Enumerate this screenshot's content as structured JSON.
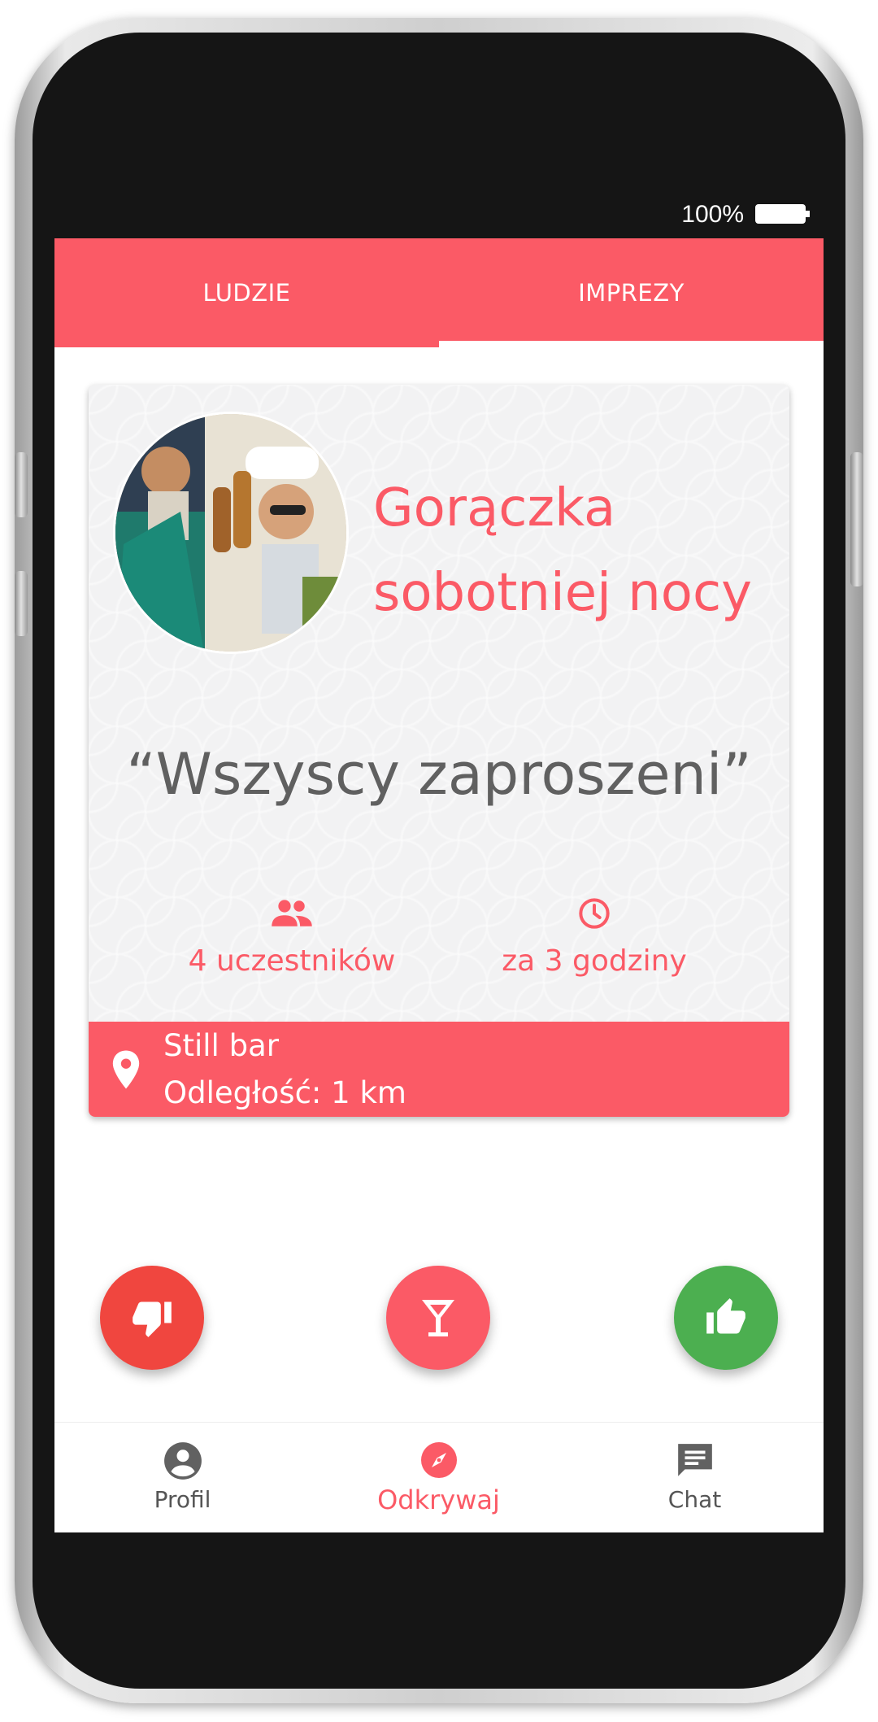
{
  "status_bar": {
    "battery_percent": "100%"
  },
  "tabs": [
    {
      "label": "LUDZIE",
      "active": false
    },
    {
      "label": "IMPREZY",
      "active": true
    }
  ],
  "event": {
    "title_line1": "Gorączka",
    "title_line2": "sobotniej nocy",
    "quote": "“Wszyscy zaproszeni”",
    "participants": "4 uczestników",
    "time_until": "za 3 godziny",
    "venue_name": "Still bar",
    "distance": "Odległość: 1 km"
  },
  "actions": {
    "dislike_icon": "thumb-down-icon",
    "drink_icon": "cocktail-glass-icon",
    "like_icon": "thumb-up-icon"
  },
  "bottom_nav": [
    {
      "label": "Profil",
      "icon": "account-circle-icon",
      "active": false
    },
    {
      "label": "Odkrywaj",
      "icon": "compass-icon",
      "active": true
    },
    {
      "label": "Chat",
      "icon": "chat-bubble-icon",
      "active": false
    }
  ],
  "colors": {
    "accent": "#fb5a66",
    "dislike": "#f0463f",
    "like": "#4caf50",
    "frame": "#151515"
  }
}
